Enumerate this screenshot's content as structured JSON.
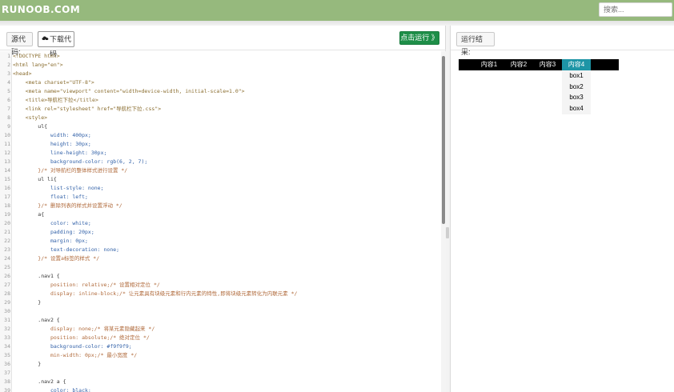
{
  "header": {
    "logo": "RUNOOB.COM",
    "search_placeholder": "搜索..."
  },
  "toolbar": {
    "source_label": "源代码:",
    "download_label": "下载代码",
    "download_icon": "cloud-download-icon",
    "run_label": "点击运行 》",
    "result_label": "运行结果:"
  },
  "code_lines": [
    "<!DOCTYPE html>",
    "<html lang=\"en\">",
    "<head>",
    "    <meta charset=\"UTF-8\">",
    "    <meta name=\"viewport\" content=\"width=device-width, initial-scale=1.0\">",
    "    <title>导航栏下拉</title>",
    "    <link rel=\"stylesheet\" href=\"导航栏下拉.css\">",
    "    <style>",
    "        ul{",
    "            width: 400px;",
    "            height: 30px;",
    "            line-height: 30px;",
    "            background-color: rgb(6, 2, 7);",
    "        }/* 对导航栏的整体样式进行设置 */",
    "        ul li{",
    "            list-style: none;",
    "            float: left;",
    "        }/* 删除列表的样式并设置浮动 */",
    "        a{",
    "            color: white;",
    "            padding: 20px;",
    "            margin: 0px;",
    "            text-decoration: none;",
    "        }/* 设置a标签的样式 */",
    "",
    "        .nav1 {",
    "            position: relative;/* 设置相对定位 */",
    "            display: inline-block;/* 让元素具有块级元素和行内元素的特性,即将块级元素转化为内联元素 */",
    "        }",
    "",
    "        .nav2 {",
    "            display: none;/* 将某元素隐藏起来 */",
    "            position: absolute;/* 绝对定位 */",
    "            background-color: #f9f9f9;",
    "            min-width: 0px;/* 最小宽度 */",
    "        }",
    "",
    "        .nav2 a {",
    "            color: black;"
  ],
  "result": {
    "nav_items": [
      "内容1",
      "内容2",
      "内容3",
      "内容4"
    ],
    "active_index": 3,
    "dropdown_items": [
      "box1",
      "box2",
      "box3",
      "box4"
    ]
  },
  "colors": {
    "header_bg": "#96b97d",
    "run_button": "#1e8e48",
    "nav_bg": "#000000",
    "nav_active": "#1e95a6"
  }
}
